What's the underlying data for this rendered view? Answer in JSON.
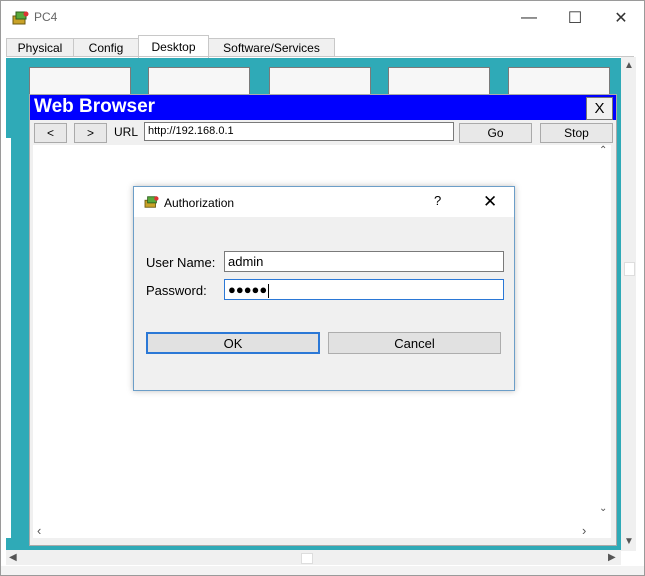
{
  "window": {
    "title": "PC4",
    "controls": {
      "minimize": "—",
      "maximize": "☐",
      "close": "✕"
    }
  },
  "tabs": [
    {
      "label": "Physical",
      "active": false
    },
    {
      "label": "Config",
      "active": false
    },
    {
      "label": "Desktop",
      "active": true
    },
    {
      "label": "Software/Services",
      "active": false
    }
  ],
  "browser": {
    "title": "Web Browser",
    "close_label": "X",
    "back_label": "<",
    "forward_label": ">",
    "url_label": "URL",
    "url_value": "http://192.168.0.1",
    "go_label": "Go",
    "stop_label": "Stop"
  },
  "dialog": {
    "title": "Authorization",
    "help_label": "?",
    "close_label": "✕",
    "username_label": "User Name:",
    "username_value": "admin",
    "password_label": "Password:",
    "password_value": "●●●●●",
    "ok_label": "OK",
    "cancel_label": "Cancel"
  },
  "scroll": {
    "up": "▲",
    "down": "▼",
    "left": "◀",
    "right": "▶",
    "c_up": "⌃",
    "c_down": "⌄",
    "c_left": "‹",
    "c_right": "›"
  },
  "colors": {
    "desktop": "#2faab7",
    "browser_title": "#0000ff",
    "focus": "#2b78d6"
  }
}
